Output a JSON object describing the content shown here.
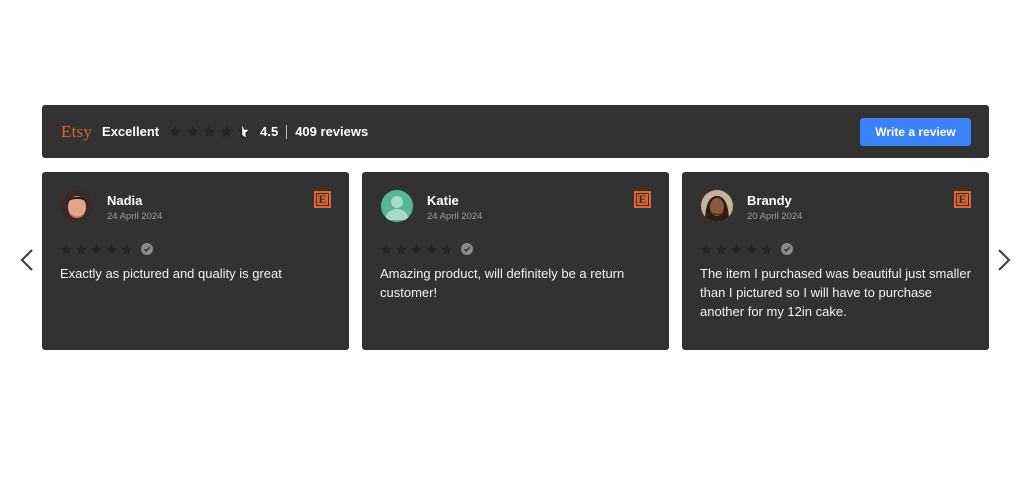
{
  "summary": {
    "brand": "Etsy",
    "rating_word": "Excellent",
    "score": "4.5",
    "review_count": "409 reviews",
    "write_button": "Write a review",
    "average_rating": 4.5,
    "max_rating": 5
  },
  "colors": {
    "panel": "#323232",
    "accent": "#e0632a",
    "button": "#3a82f7",
    "star_empty": "#252525"
  },
  "reviews": [
    {
      "author": "Nadia",
      "date": "24 April 2024",
      "rating": 5,
      "avatar": "photo-avatar",
      "text": "Exactly as pictured and quality is great"
    },
    {
      "author": "Katie",
      "date": "24 April 2024",
      "rating": 5,
      "avatar": "default-user-avatar",
      "text": "Amazing product, will definitely be a return customer!"
    },
    {
      "author": "Brandy",
      "date": "20 April 2024",
      "rating": 5,
      "avatar": "photo-avatar",
      "text": "The item I purchased was beautiful just smaller than I pictured so I will have to purchase another for my 12in cake."
    }
  ],
  "icons": {
    "prev": "chevron-left-icon",
    "next": "chevron-right-icon",
    "source": "etsy-logo-icon",
    "verified": "verified-check-icon"
  }
}
